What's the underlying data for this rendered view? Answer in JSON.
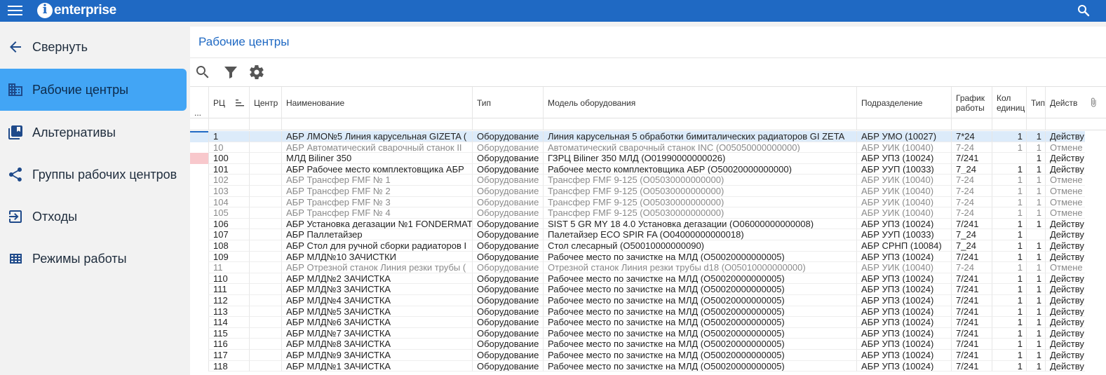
{
  "app": {
    "logo_text": "enterprise"
  },
  "sidebar": {
    "items": [
      {
        "label": "Свернуть",
        "icon": "arrow-left-icon"
      },
      {
        "label": "Рабочие центры",
        "icon": "building-icon"
      },
      {
        "label": "Альтернативы",
        "icon": "book-icon"
      },
      {
        "label": "Группы рабочих центров",
        "icon": "share-icon"
      },
      {
        "label": "Отходы",
        "icon": "exit-icon"
      },
      {
        "label": "Режимы работы",
        "icon": "grid-icon"
      }
    ]
  },
  "main": {
    "title": "Рабочие центры",
    "corner": "...",
    "columns": [
      "РЦ",
      "Центр",
      "Наименование",
      "Тип",
      "Модель оборудования",
      "Подразделение",
      "График работы",
      "Кол единиц",
      "Тип",
      "Действ"
    ],
    "rows": [
      [
        "1",
        "",
        "АБР ЛМО№5 Линия карусельная GIZETA (",
        "Оборудование",
        "Линия карусельная 5 обработки бимиталических радиаторов GI ZETA",
        "АБР УМО (10027)",
        "7*24",
        "1",
        "1",
        "Действу"
      ],
      [
        "10",
        "",
        "АБР Автоматический сварочный станок II",
        "Оборудование",
        "Автоматический сварочный станок INC (O05050000000000)",
        "АБР УИК (10040)",
        "7-24",
        "1",
        "1",
        "Отмене"
      ],
      [
        "100",
        "",
        "МЛД  Biliner 350",
        "Оборудование",
        "ГЗРЦ Biliner 350 МЛД (O01990000000026)",
        "АБР УПЗ (10024)",
        "7/241",
        "",
        "1",
        "Действу"
      ],
      [
        "101",
        "",
        "АБР Рабочее место комплектовщика АБР",
        "Оборудование",
        "Рабочее место комплектовщика АБР (O50020000000000)",
        "АБР УУП (10033)",
        "7_24",
        "1",
        "1",
        "Действу"
      ],
      [
        "102",
        "",
        "АБР Трансфер FMF № 1",
        "Оборудование",
        "Трансфер FMF 9-125 (O05030000000000)",
        "АБР УИК (10040)",
        "7-24",
        "1",
        "1",
        "Отмене"
      ],
      [
        "103",
        "",
        "АБР Трансфер FMF № 2",
        "Оборудование",
        "Трансфер FMF 9-125 (O05030000000000)",
        "АБР УИК (10040)",
        "7-24",
        "1",
        "1",
        "Отмене"
      ],
      [
        "104",
        "",
        "АБР Трансфер FMF № 3",
        "Оборудование",
        "Трансфер FMF 9-125 (O05030000000000)",
        "АБР УИК (10040)",
        "7-24",
        "1",
        "1",
        "Отмене"
      ],
      [
        "105",
        "",
        "АБР Трансфер FMF № 4",
        "Оборудование",
        "Трансфер FMF 9-125 (O05030000000000)",
        "АБР УИК (10040)",
        "7-24",
        "1",
        "1",
        "Отмене"
      ],
      [
        "106",
        "",
        "АБР Установка дегазации №1 FONDERMAT",
        "Оборудование",
        "SIST 5 GR MY 18 4.0 Установка дегазации (O06000000000008)",
        "АБР УПЗ (10024)",
        "7/241",
        "1",
        "1",
        "Действу"
      ],
      [
        "107",
        "",
        "АБР Паллетайзер",
        "Оборудование",
        "Палетайзер ECO SPIR FA (O04000000000018)",
        "АБР УУП (10033)",
        "7_24",
        "1",
        "",
        "Действу"
      ],
      [
        "108",
        "",
        "АБР Стол для ручной сборки радиаторов I",
        "Оборудование",
        "Стол слесарный (O50010000000090)",
        "АБР СРНП (10084)",
        "7_24",
        "1",
        "1",
        "Действу"
      ],
      [
        "109",
        "",
        "АБР МЛД№10 ЗАЧИСТКИ",
        "Оборудование",
        "Рабочее место по зачистке на МЛД (O50020000000005)",
        "АБР УПЗ (10024)",
        "7/241",
        "1",
        "1",
        "Действу"
      ],
      [
        "11",
        "",
        "АБР Отрезной станок Линия резки трубы (",
        "Оборудование",
        "Отрезной станок Линия резки трубы d18 (O05010000000000)",
        "АБР УИК (10040)",
        "7-24",
        "1",
        "1",
        "Отмене"
      ],
      [
        "110",
        "",
        "АБР МЛД№2 ЗАЧИСТКА",
        "Оборудование",
        "Рабочее место по зачистке на МЛД (O50020000000005)",
        "АБР УПЗ (10024)",
        "7/241",
        "1",
        "1",
        "Действу"
      ],
      [
        "111",
        "",
        "АБР МЛД№3 ЗАЧИСТКА",
        "Оборудование",
        "Рабочее место по зачистке на МЛД (O50020000000005)",
        "АБР УПЗ (10024)",
        "7/241",
        "1",
        "1",
        "Действу"
      ],
      [
        "112",
        "",
        "АБР МЛД№4 ЗАЧИСТКА",
        "Оборудование",
        "Рабочее место по зачистке на МЛД (O50020000000005)",
        "АБР УПЗ (10024)",
        "7/241",
        "1",
        "1",
        "Действу"
      ],
      [
        "113",
        "",
        "АБР МЛД№5 ЗАЧИСТКА",
        "Оборудование",
        "Рабочее место по зачистке на МЛД (O50020000000005)",
        "АБР УПЗ (10024)",
        "7/241",
        "1",
        "1",
        "Действу"
      ],
      [
        "114",
        "",
        "АБР МЛД№6 ЗАЧИСТКА",
        "Оборудование",
        "Рабочее место по зачистке на МЛД (O50020000000005)",
        "АБР УПЗ (10024)",
        "7/241",
        "1",
        "1",
        "Действу"
      ],
      [
        "115",
        "",
        "АБР МЛД№7 ЗАЧИСТКА",
        "Оборудование",
        "Рабочее место по зачистке на МЛД (O50020000000005)",
        "АБР УПЗ (10024)",
        "7/241",
        "1",
        "1",
        "Действу"
      ],
      [
        "116",
        "",
        "АБР МЛД№8 ЗАЧИСТКА",
        "Оборудование",
        "Рабочее место по зачистке на МЛД (O50020000000005)",
        "АБР УПЗ (10024)",
        "7/241",
        "1",
        "1",
        "Действу"
      ],
      [
        "117",
        "",
        "АБР МЛД№9 ЗАЧИСТКА",
        "Оборудование",
        "Рабочее место по зачистке на МЛД (O50020000000005)",
        "АБР УПЗ (10024)",
        "7/241",
        "1",
        "1",
        "Действу"
      ],
      [
        "118",
        "",
        "АБР МЛД№1 ЗАЧИСТКА",
        "Оборудование",
        "Рабочее место по зачистке на МЛД (O50020000000005)",
        "АБР УПЗ (10024)",
        "7/241",
        "1",
        "1",
        "Действу"
      ]
    ],
    "row_states": [
      "selected",
      "cancelled",
      "pink",
      "",
      "cancelled",
      "cancelled",
      "cancelled",
      "cancelled",
      "",
      "",
      "",
      "",
      "cancelled",
      "",
      "",
      "",
      "",
      "",
      "",
      "",
      "",
      ""
    ]
  },
  "colors": {
    "topbar": "#1f69c3",
    "active_nav": "#42a5f5",
    "title": "#1f69c3",
    "cancelled_text": "#8a8a8a"
  }
}
